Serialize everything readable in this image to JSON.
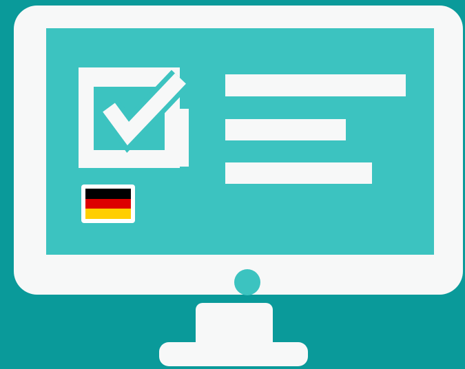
{
  "illustration": {
    "icon": "computer-monitor-with-checklist",
    "colors": {
      "background": "#0a9a9a",
      "monitor": "#f7f8f8",
      "screen": "#3cc3c0"
    },
    "checkbox_icon": "checked-checkbox-icon",
    "text_lines": 3,
    "language_flag": {
      "icon": "german-flag-icon",
      "stripes": [
        "#000000",
        "#dd0000",
        "#ffce00"
      ]
    }
  }
}
